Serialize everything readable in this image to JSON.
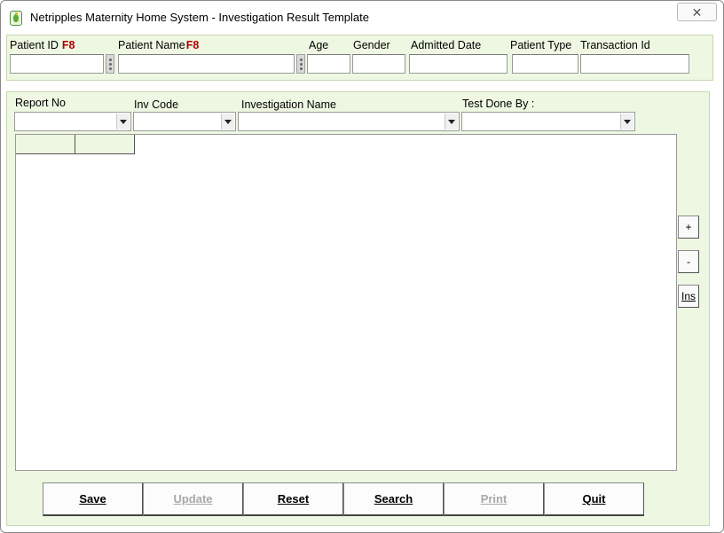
{
  "window": {
    "title": "Netripples Maternity Home System  - Investigation Result Template",
    "close_label": "✕"
  },
  "patient": {
    "patient_id_label": "Patient ID",
    "patient_id_hotkey": "F8",
    "patient_id_value": "",
    "patient_name_label": "Patient Name",
    "patient_name_hotkey": "F8",
    "patient_name_value": "",
    "age_label": "Age",
    "age_value": "",
    "gender_label": "Gender",
    "gender_value": "",
    "admitted_date_label": "Admitted Date",
    "admitted_date_value": "",
    "patient_type_label": "Patient Type",
    "patient_type_value": "",
    "transaction_id_label": "Transaction Id",
    "transaction_id_value": ""
  },
  "filters": {
    "report_no_label": "Report No",
    "report_no_value": "",
    "inv_code_label": "Inv Code",
    "inv_code_value": "",
    "investigation_name_label": "Investigation Name",
    "investigation_name_value": "",
    "test_done_by_label": "Test Done By :",
    "test_done_by_value": ""
  },
  "grid": {
    "columns": [
      "",
      ""
    ]
  },
  "side_buttons": {
    "add_label": "+",
    "remove_label": "-",
    "insert_label": "Ins"
  },
  "actions": {
    "save_label": "Save",
    "update_label": "Update",
    "reset_label": "Reset",
    "search_label": "Search",
    "print_label": "Print",
    "quit_label": "Quit"
  }
}
